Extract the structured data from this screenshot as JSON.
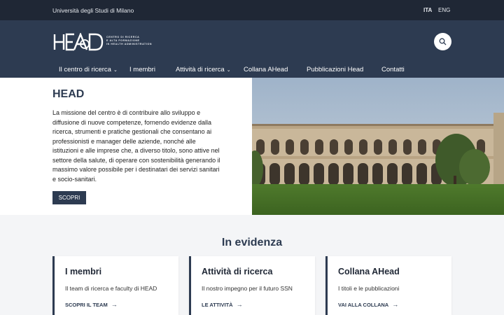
{
  "topbar": {
    "university": "Università degli Studi di Milano",
    "lang_ita": "ITA",
    "lang_eng": "ENG"
  },
  "header": {
    "logo_text_line1": "CENTRO DI RICERCA",
    "logo_text_line2": "E ALTA FORMAZIONE",
    "logo_text_line3": "IN HEALTH ADMINISTRATION",
    "search_icon": "search-icon"
  },
  "nav": {
    "items": [
      {
        "label": "Il centro di ricerca",
        "dropdown": true
      },
      {
        "label": "I membri",
        "dropdown": false
      },
      {
        "label": "Attività di ricerca",
        "dropdown": true
      },
      {
        "label": "Collana AHead",
        "dropdown": false
      },
      {
        "label": "Pubblicazioni Head",
        "dropdown": false
      },
      {
        "label": "Contatti",
        "dropdown": false
      }
    ],
    "chevron": "⌄"
  },
  "hero": {
    "title": "HEAD",
    "text": "La missione del centro è di contribuire allo sviluppo e diffusione di nuove competenze, fornendo evidenze dalla ricerca, strumenti e pratiche gestionali che consentano ai professionisti e manager delle aziende, nonché alle istituzioni e alle imprese che, a diverso titolo, sono attive nel settore della salute, di operare con sostenibilità generando il massimo valore possibile per i destinatari dei servizi sanitari e socio-sanitari.",
    "button": "SCOPRI"
  },
  "highlights": {
    "title": "In evidenza",
    "cards": [
      {
        "title": "I membri",
        "desc": "Il team di ricerca e faculty di HEAD",
        "link": "SCOPRI IL TEAM"
      },
      {
        "title": "Attività di ricerca",
        "desc": "Il nostro impegno per il futuro SSN",
        "link": "LE ATTIVITÀ"
      },
      {
        "title": "Collana AHead",
        "desc": "I titoli e le pubblicazioni",
        "link": "VAI ALLA COLLANA"
      }
    ],
    "arrow": "→"
  },
  "colors": {
    "topbar": "#1f2735",
    "header": "#2d3b51",
    "accent": "#2d3b51"
  }
}
